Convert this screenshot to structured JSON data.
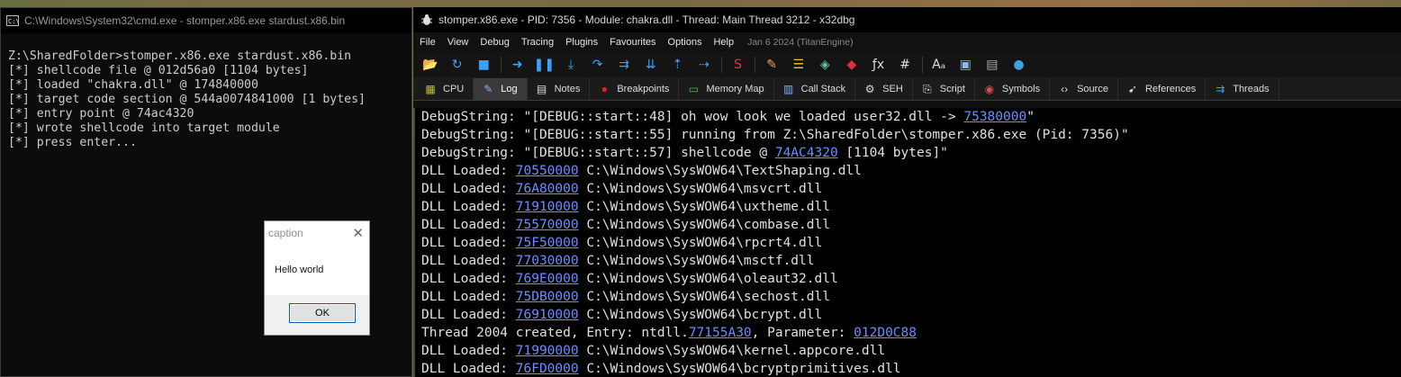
{
  "cmd": {
    "title": "C:\\Windows\\System32\\cmd.exe - stomper.x86.exe  stardust.x86.bin",
    "lines": [
      "Z:\\SharedFolder>stomper.x86.exe stardust.x86.bin",
      "[*] shellcode file @ 012d56a0 [1104 bytes]",
      "[*] loaded \"chakra.dll\" @ 174840000",
      "[*] target code section @ 544a0074841000 [1 bytes]",
      "[*] entry point @ 74ac4320",
      "[*] wrote shellcode into target module",
      "[*] press enter..."
    ]
  },
  "msgbox": {
    "caption": "caption",
    "text": "Hello world",
    "ok_label": "OK"
  },
  "debugger": {
    "title": "stomper.x86.exe - PID: 7356 - Module: chakra.dll - Thread: Main Thread 3212 - x32dbg",
    "menu": [
      "File",
      "View",
      "Debug",
      "Tracing",
      "Plugins",
      "Favourites",
      "Options",
      "Help"
    ],
    "build_date": "Jan 6 2024 (TitanEngine)",
    "tabs": [
      {
        "label": "CPU",
        "icon": "cpu-icon"
      },
      {
        "label": "Log",
        "icon": "log-icon"
      },
      {
        "label": "Notes",
        "icon": "notes-icon"
      },
      {
        "label": "Breakpoints",
        "icon": "breakpoint-icon"
      },
      {
        "label": "Memory Map",
        "icon": "memory-map-icon"
      },
      {
        "label": "Call Stack",
        "icon": "call-stack-icon"
      },
      {
        "label": "SEH",
        "icon": "seh-icon"
      },
      {
        "label": "Script",
        "icon": "script-icon"
      },
      {
        "label": "Symbols",
        "icon": "symbols-icon"
      },
      {
        "label": "Source",
        "icon": "source-icon"
      },
      {
        "label": "References",
        "icon": "references-icon"
      },
      {
        "label": "Threads",
        "icon": "threads-icon"
      }
    ],
    "active_tab": "Log",
    "log": [
      {
        "pre": "DebugString: \"[DEBUG::start::48] oh wow look we loaded user32.dll -> ",
        "addr": "75380000",
        "post": "\""
      },
      {
        "pre": "DebugString: \"[DEBUG::start::55] running from Z:\\SharedFolder\\stomper.x86.exe (Pid: 7356)\"",
        "addr": "",
        "post": ""
      },
      {
        "pre": "DebugString: \"[DEBUG::start::57] shellcode @ ",
        "addr": "74AC4320",
        "post": " [1104 bytes]\""
      },
      {
        "pre": "DLL Loaded: ",
        "addr": "70550000",
        "post": " C:\\Windows\\SysWOW64\\TextShaping.dll"
      },
      {
        "pre": "DLL Loaded: ",
        "addr": "76A80000",
        "post": " C:\\Windows\\SysWOW64\\msvcrt.dll"
      },
      {
        "pre": "DLL Loaded: ",
        "addr": "71910000",
        "post": " C:\\Windows\\SysWOW64\\uxtheme.dll"
      },
      {
        "pre": "DLL Loaded: ",
        "addr": "75570000",
        "post": " C:\\Windows\\SysWOW64\\combase.dll"
      },
      {
        "pre": "DLL Loaded: ",
        "addr": "75F50000",
        "post": " C:\\Windows\\SysWOW64\\rpcrt4.dll"
      },
      {
        "pre": "DLL Loaded: ",
        "addr": "77030000",
        "post": " C:\\Windows\\SysWOW64\\msctf.dll"
      },
      {
        "pre": "DLL Loaded: ",
        "addr": "769E0000",
        "post": " C:\\Windows\\SysWOW64\\oleaut32.dll"
      },
      {
        "pre": "DLL Loaded: ",
        "addr": "75DB0000",
        "post": " C:\\Windows\\SysWOW64\\sechost.dll"
      },
      {
        "pre": "DLL Loaded: ",
        "addr": "76910000",
        "post": " C:\\Windows\\SysWOW64\\bcrypt.dll"
      },
      {
        "pre": "Thread 2004 created, Entry: ntdll.",
        "addr": "77155A30",
        "post": ", Parameter: ",
        "addr2": "012D0C88"
      },
      {
        "pre": "DLL Loaded: ",
        "addr": "71990000",
        "post": " C:\\Windows\\SysWOW64\\kernel.appcore.dll"
      },
      {
        "pre": "DLL Loaded: ",
        "addr": "76FD0000",
        "post": " C:\\Windows\\SysWOW64\\bcryptprimitives.dll"
      }
    ]
  },
  "toolbar_icons": [
    {
      "name": "open-icon",
      "glyph": "📂",
      "color": "#e0b040"
    },
    {
      "name": "restart-icon",
      "glyph": "↻",
      "color": "#3aa0ff"
    },
    {
      "name": "stop-icon",
      "glyph": "■",
      "color": "#3aa0ff"
    },
    {
      "name": "run-icon",
      "glyph": "➜",
      "color": "#3aa0ff"
    },
    {
      "name": "pause-icon",
      "glyph": "❚❚",
      "color": "#3aa0ff"
    },
    {
      "name": "step-into-icon",
      "glyph": "⤓",
      "color": "#3aa0ff"
    },
    {
      "name": "step-over-icon",
      "glyph": "↷",
      "color": "#3aa0ff"
    },
    {
      "name": "trace-into-icon",
      "glyph": "⇉",
      "color": "#3aa0ff"
    },
    {
      "name": "trace-over-icon",
      "glyph": "⇊",
      "color": "#3aa0ff"
    },
    {
      "name": "execute-till-return-icon",
      "glyph": "⇡",
      "color": "#3aa0ff"
    },
    {
      "name": "run-to-user-code-icon",
      "glyph": "⇢",
      "color": "#3aa0ff"
    },
    {
      "name": "scylla-icon",
      "glyph": "S",
      "color": "#d04040"
    },
    {
      "name": "patch-icon",
      "glyph": "✎",
      "color": "#f0a050"
    },
    {
      "name": "comments-icon",
      "glyph": "☰",
      "color": "#f0c040"
    },
    {
      "name": "labels-icon",
      "glyph": "◈",
      "color": "#60c0a0"
    },
    {
      "name": "bookmarks-icon",
      "glyph": "◆",
      "color": "#e03040"
    },
    {
      "name": "functions-icon",
      "glyph": "ƒx",
      "color": "#dddddd"
    },
    {
      "name": "hash-icon",
      "glyph": "#",
      "color": "#dddddd"
    },
    {
      "name": "font-icon",
      "glyph": "Aₐ",
      "color": "#dddddd"
    },
    {
      "name": "module-icon",
      "glyph": "▣",
      "color": "#8ab4ff"
    },
    {
      "name": "calculator-icon",
      "glyph": "▤",
      "color": "#aaaaaa"
    },
    {
      "name": "globe-icon",
      "glyph": "●",
      "color": "#40a0e0"
    }
  ]
}
